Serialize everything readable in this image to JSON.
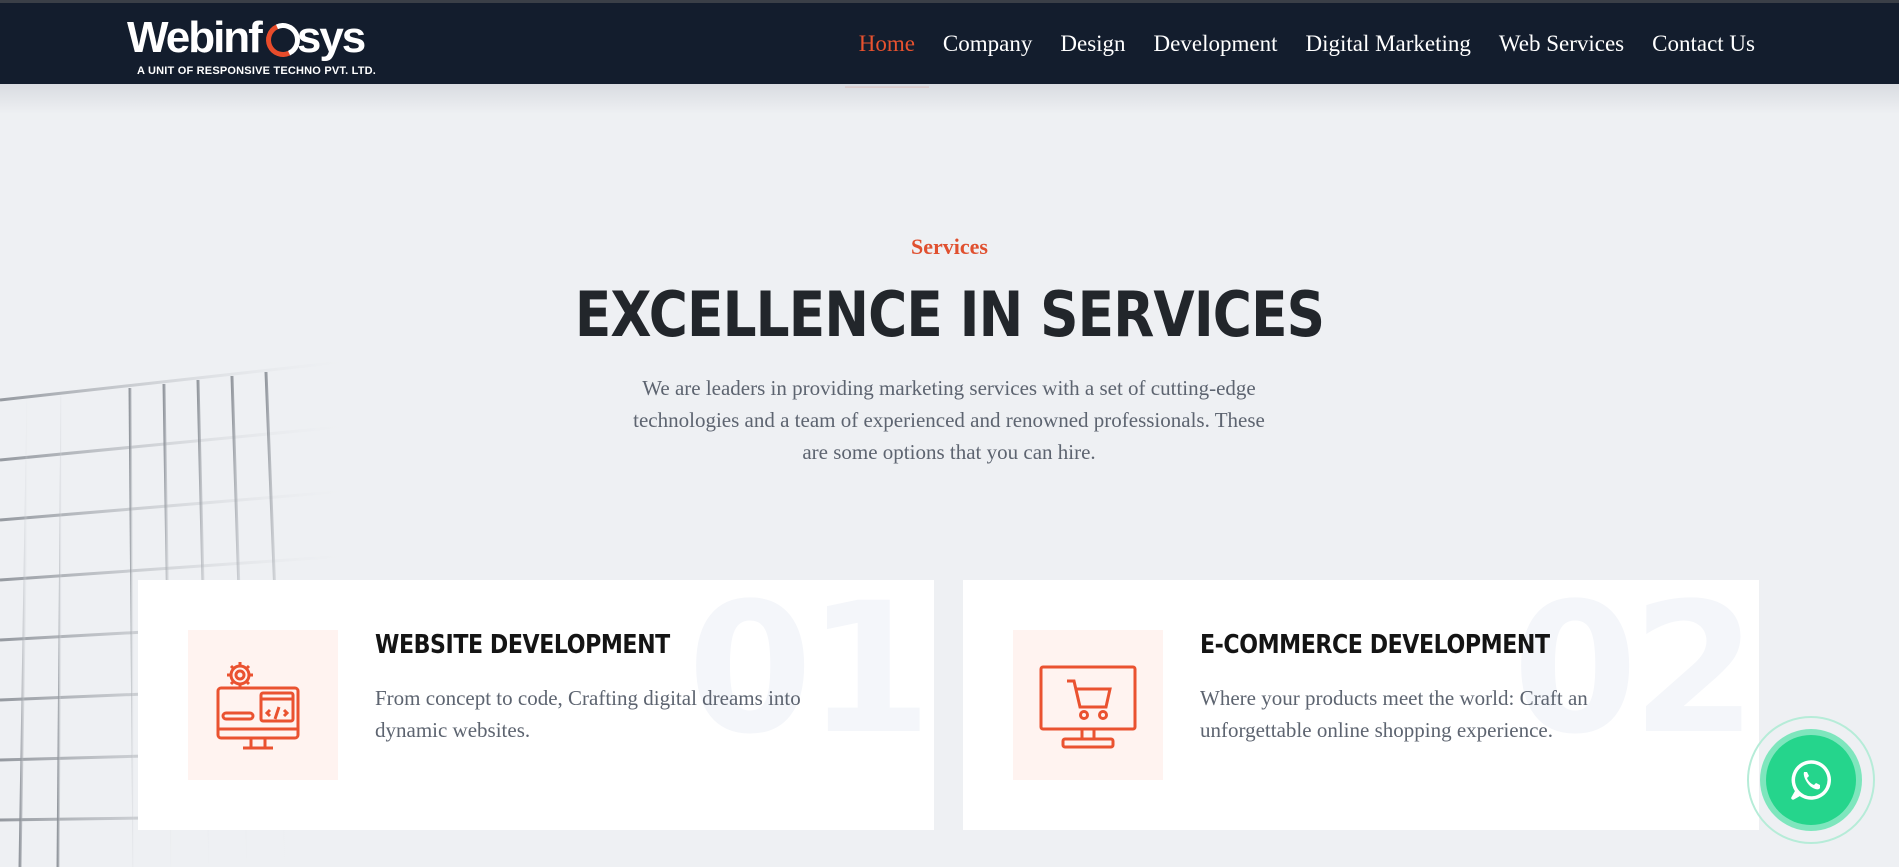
{
  "header": {
    "logo_text": "Webinfosys",
    "logo_sub": "A UNIT OF RESPONSIVE TECHNO PVT. LTD.",
    "nav": [
      {
        "label": "Home",
        "active": true
      },
      {
        "label": "Company"
      },
      {
        "label": "Design"
      },
      {
        "label": "Development"
      },
      {
        "label": "Digital Marketing"
      },
      {
        "label": "Web Services"
      },
      {
        "label": "Contact Us"
      }
    ]
  },
  "services": {
    "label": "Services",
    "title": "EXCELLENCE IN SERVICES",
    "description": "We are leaders in providing marketing services with a set of cutting-edge technologies and a team of experienced and renowned professionals. These are some options that you can hire.",
    "cards": [
      {
        "number": "01",
        "title": "WEBSITE DEVELOPMENT",
        "text": "From concept to code, Crafting digital dreams into dynamic websites.",
        "icon": "web-development-icon"
      },
      {
        "number": "02",
        "title": "E-COMMERCE DEVELOPMENT",
        "text": "Where your products meet the world: Craft an unforgettable online shopping experience.",
        "icon": "shopping-cart-monitor-icon"
      }
    ]
  },
  "colors": {
    "accent": "#e8522f",
    "header_bg": "#131d2d",
    "whatsapp": "#25d58c"
  },
  "floating": {
    "icon": "whatsapp-icon"
  }
}
